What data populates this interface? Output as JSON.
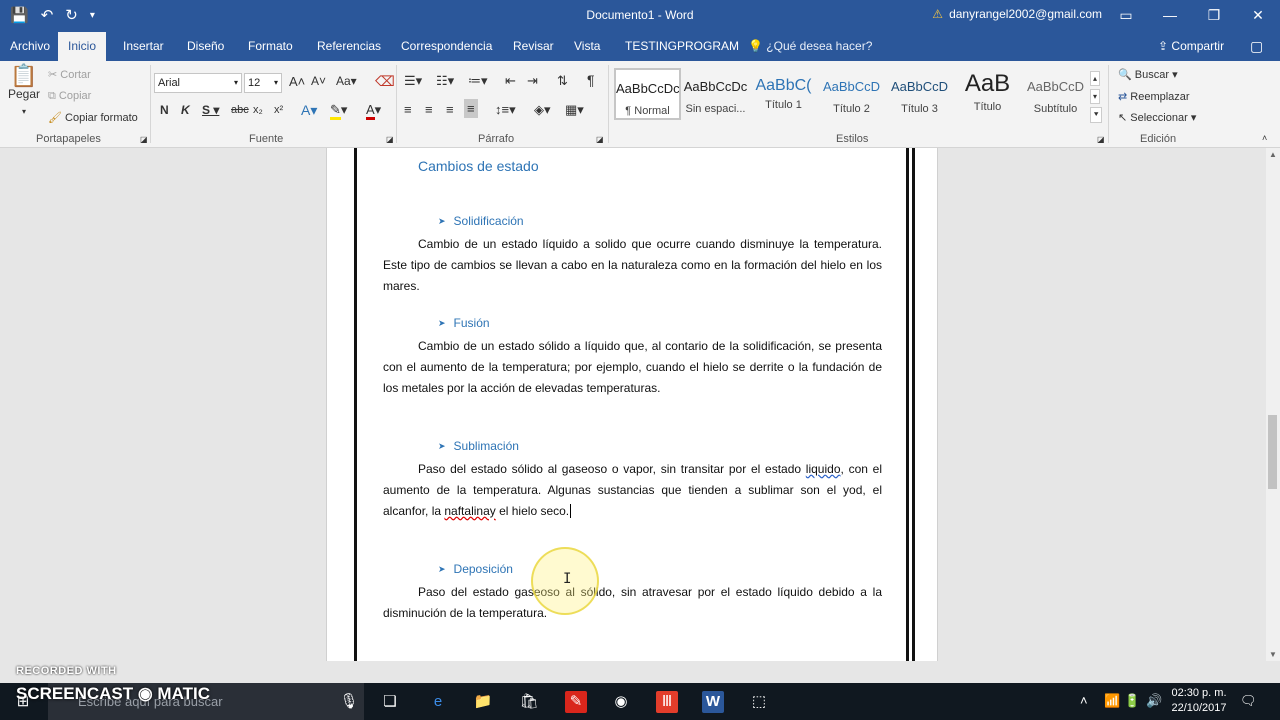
{
  "titlebar": {
    "doc_title": "Documento1 - Word",
    "user_email": "danyrangel2002@gmail.com"
  },
  "tabs": [
    {
      "label": "Archivo"
    },
    {
      "label": "Inicio"
    },
    {
      "label": "Insertar"
    },
    {
      "label": "Diseño"
    },
    {
      "label": "Formato"
    },
    {
      "label": "Referencias"
    },
    {
      "label": "Correspondencia"
    },
    {
      "label": "Revisar"
    },
    {
      "label": "Vista"
    },
    {
      "label": "TESTINGPROGRAM"
    }
  ],
  "tell_me": "¿Qué desea hacer?",
  "share_label": "Compartir",
  "ribbon": {
    "clipboard": {
      "paste": "Pegar",
      "cut": "Cortar",
      "copy": "Copiar",
      "format_painter": "Copiar formato",
      "group": "Portapapeles"
    },
    "font": {
      "name": "Arial",
      "size": "12",
      "group": "Fuente"
    },
    "paragraph": {
      "group": "Párrafo"
    },
    "styles": {
      "group": "Estilos",
      "items": [
        {
          "sample": "AaBbCcDc",
          "name": "¶ Normal"
        },
        {
          "sample": "AaBbCcDc",
          "name": "Sin espaci..."
        },
        {
          "sample": "AaBbC(",
          "name": "Título 1"
        },
        {
          "sample": "AaBbCcD",
          "name": "Título 2"
        },
        {
          "sample": "AaBbCcD",
          "name": "Título 3"
        },
        {
          "sample": "AaB",
          "name": "Título"
        },
        {
          "sample": "AaBbCcD",
          "name": "Subtítulo"
        }
      ]
    },
    "editing": {
      "find": "Buscar",
      "replace": "Reemplazar",
      "select": "Seleccionar",
      "group": "Edición"
    }
  },
  "document": {
    "heading": "Cambios de estado",
    "sections": [
      {
        "title": "Solidificación",
        "text": "Cambio de un estado líquido a solido que ocurre cuando disminuye la temperatura. Este tipo de cambios se llevan a cabo en la naturaleza como en la formación del hielo en los mares."
      },
      {
        "title": "Fusión",
        "text": "Cambio de un estado sólido a líquido que, al contario de la solidificación, se presenta con el aumento de la temperatura; por ejemplo, cuando el hielo se derrite o la fundación de los metales por la acción de elevadas temperaturas."
      },
      {
        "title": "Sublimación",
        "text_a": "Paso del estado sólido al gaseoso o vapor, sin transitar por el estado ",
        "text_b": "liquido",
        "text_c": ", con el aumento de la temperatura. Algunas sustancias que tienden a sublimar son el yod, el alcanfor, la ",
        "text_d": "naftalinay",
        "text_e": " el hielo seco."
      },
      {
        "title": "Deposición",
        "text": "Paso del estado gaseoso al sólido, sin atravesar por el estado líquido debido a la disminución de la temperatura."
      }
    ]
  },
  "taskbar": {
    "search_placeholder": "Escribe aquí para buscar",
    "time": "02:30 p. m.",
    "date": "22/10/2017"
  },
  "watermark": {
    "recorded": "RECORDED WITH",
    "brand": "SCREENCAST ◉ MATIC"
  },
  "colors": {
    "word_blue": "#2b579a",
    "heading_blue": "#2e74b5"
  }
}
